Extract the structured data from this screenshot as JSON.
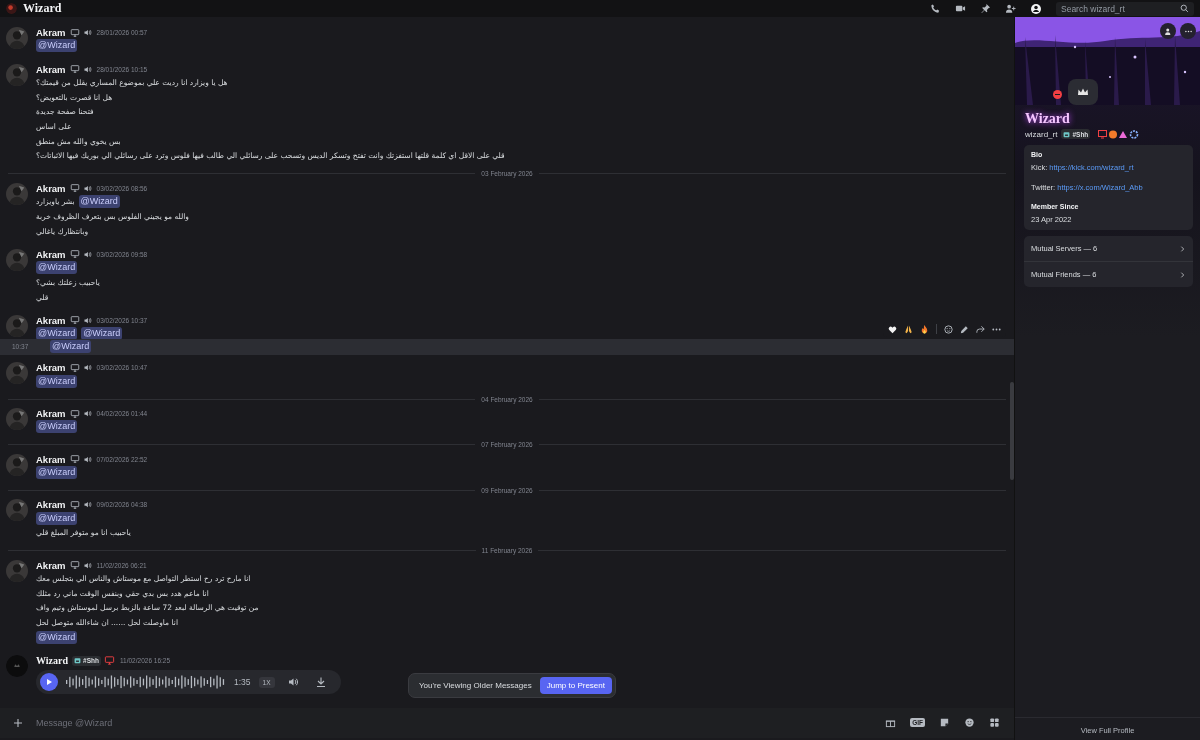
{
  "window": {
    "title": "Wizard",
    "search": {
      "placeholder": "Search wizard_rt"
    }
  },
  "messages": [
    {
      "kind": "message",
      "author": "Akram",
      "timestamp": "28/01/2026 00:57",
      "lines": [
        [
          {
            "kind": "mention",
            "text": "@Wizard"
          }
        ]
      ]
    },
    {
      "kind": "message",
      "author": "Akram",
      "timestamp": "28/01/2026 10:15",
      "lines": [
        [
          {
            "kind": "text",
            "text": "هل يا ويزارد انا رديت علي بموضوع المساري يقلل من قيمتك؟"
          }
        ],
        [
          {
            "kind": "text",
            "text": "هل انا قصرت بالتعويض؟"
          }
        ],
        [
          {
            "kind": "text",
            "text": "فتحنا صفحة جديدة"
          }
        ],
        [
          {
            "kind": "text",
            "text": "على اساس"
          }
        ],
        [
          {
            "kind": "text",
            "text": "بس يخوي والله مش منطق"
          }
        ],
        [
          {
            "kind": "text",
            "text": "قلي على الاقل اي كلمة قلتها استفزتك وانت تفتح وتسكر الديس وتسحب على رسائلي الي طالب فيها فلوس وترد على رسائلي الي بوريك فيها الاثباتات؟"
          }
        ]
      ]
    },
    {
      "kind": "divider",
      "label": "03 February 2026"
    },
    {
      "kind": "message",
      "author": "Akram",
      "timestamp": "03/02/2026 08:56",
      "lines": [
        [
          {
            "kind": "text",
            "text": "بشر ياويزارد"
          },
          {
            "kind": "mention",
            "text": "@Wizard"
          }
        ],
        [
          {
            "kind": "text",
            "text": "والله مو يجيني الفلوس بس بتعرف الظروف خربة"
          }
        ],
        [
          {
            "kind": "text",
            "text": "وبانتظارك ياغالي"
          }
        ]
      ]
    },
    {
      "kind": "message",
      "author": "Akram",
      "timestamp": "03/02/2026 09:58",
      "lines": [
        [
          {
            "kind": "mention",
            "text": "@Wizard"
          }
        ],
        [
          {
            "kind": "text",
            "text": "ياحبيب زعلتك بشي؟"
          }
        ],
        [
          {
            "kind": "text",
            "text": "قلي"
          }
        ]
      ]
    },
    {
      "kind": "message",
      "author": "Akram",
      "timestamp": "03/02/2026 10:37",
      "lines": [
        [
          {
            "kind": "mention",
            "text": "@Wizard"
          },
          {
            "kind": "mention",
            "text": "@Wizard"
          }
        ]
      ]
    },
    {
      "kind": "continuation",
      "time": "10:37",
      "hovered": true,
      "lines": [
        [
          {
            "kind": "mention",
            "text": "@Wizard"
          }
        ]
      ]
    },
    {
      "kind": "message",
      "author": "Akram",
      "timestamp": "03/02/2026 10:47",
      "lines": [
        [
          {
            "kind": "mention",
            "text": "@Wizard"
          }
        ]
      ]
    },
    {
      "kind": "divider",
      "label": "04 February 2026"
    },
    {
      "kind": "message",
      "author": "Akram",
      "timestamp": "04/02/2026 01:44",
      "lines": [
        [
          {
            "kind": "mention",
            "text": "@Wizard"
          }
        ]
      ]
    },
    {
      "kind": "divider",
      "label": "07 February 2026"
    },
    {
      "kind": "message",
      "author": "Akram",
      "timestamp": "07/02/2026 22:52",
      "lines": [
        [
          {
            "kind": "mention",
            "text": "@Wizard"
          }
        ]
      ]
    },
    {
      "kind": "divider",
      "label": "09 February 2026"
    },
    {
      "kind": "message",
      "author": "Akram",
      "timestamp": "09/02/2026 04:38",
      "lines": [
        [
          {
            "kind": "mention",
            "text": "@Wizard"
          }
        ],
        [
          {
            "kind": "text",
            "text": "ياحبيب انا مو متوفر المبلغ قلي"
          }
        ]
      ]
    },
    {
      "kind": "divider",
      "label": "11 February 2026"
    },
    {
      "kind": "message",
      "author": "Akram",
      "timestamp": "11/02/2026 06:21",
      "lines": [
        [
          {
            "kind": "text",
            "text": "انا مارح ترد رح استطر التواصل مع موستاش والناس الي بتجلس معك"
          }
        ],
        [
          {
            "kind": "text",
            "text": "انا ماعم هدد بس بدي حقي وبنفس الوقت ماني رد مثلك"
          }
        ],
        [
          {
            "kind": "text",
            "text": "من توقيت هي الرسالة لبعد 72 ساعة بالزبط برسل لموستاش وتيم واف"
          }
        ],
        [
          {
            "kind": "text",
            "text": "انا ماوصلت لحل ...... ان شاءالله متوصل لحل"
          }
        ],
        [
          {
            "kind": "mention",
            "text": "@Wizard"
          }
        ]
      ]
    },
    {
      "kind": "voice",
      "author": "Wizard",
      "tag": "#Shh",
      "timestamp": "11/02/2026 16:25",
      "duration": "1:35",
      "speed": "1X"
    }
  ],
  "older_notice": {
    "text": "You're Viewing Older Messages",
    "action": "Jump to Present"
  },
  "composer": {
    "placeholder": "Message @Wizard",
    "gif": "GIF"
  },
  "profile": {
    "display_name": "Wizard",
    "username": "wizard_rt",
    "tag": "#Shh",
    "do_not_disturb": true,
    "bio": {
      "heading": "Bio",
      "links": [
        {
          "label": "Kick:",
          "url": "https://kick.com/wizard_rt"
        },
        {
          "label": "Twitter:",
          "url": "https://x.com/Wizard_Abb"
        }
      ]
    },
    "member_since": {
      "heading": "Member Since",
      "date": "23 Apr 2022"
    },
    "mutuals": [
      "Mutual Servers — 6",
      "Mutual Friends — 6"
    ],
    "footer": "View Full Profile"
  }
}
